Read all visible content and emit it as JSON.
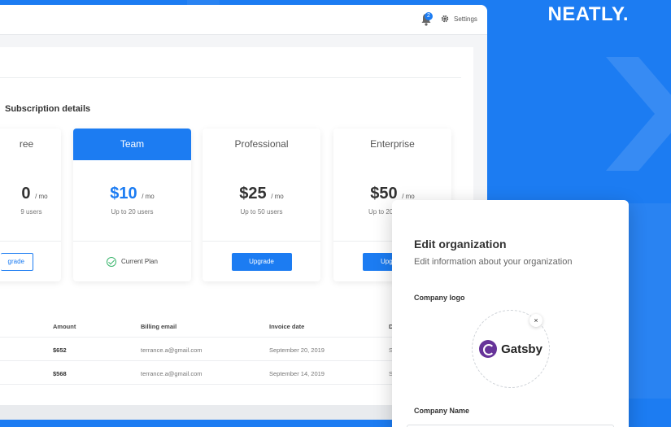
{
  "brand": {
    "name": "NEATLY."
  },
  "topbar": {
    "notification_count": "2",
    "settings_label": "Settings"
  },
  "subscription": {
    "title": "Subscription details",
    "plans": [
      {
        "name": "Free",
        "visible_name": "ree",
        "price": "0",
        "per": "/ mo",
        "users": "9 users",
        "action": "Upgrade",
        "visible_action": "grade"
      },
      {
        "name": "Team",
        "price": "$10",
        "per": "/ mo",
        "users": "Up to 20 users",
        "action": "Current Plan"
      },
      {
        "name": "Professional",
        "price": "$25",
        "per": "/ mo",
        "users": "Up to 50 users",
        "action": "Upgrade"
      },
      {
        "name": "Enterprise",
        "price": "$50",
        "per": "/ mo",
        "users": "Up to 20",
        "action": "Upg"
      }
    ]
  },
  "invoices": {
    "columns": [
      "Amount",
      "Billing email",
      "Invoice date",
      "D"
    ],
    "rows": [
      {
        "amount": "$652",
        "email": "terrance.a@gmail.com",
        "date": "September 20, 2019",
        "d": "S"
      },
      {
        "amount": "$568",
        "email": "terrance.a@gmail.com",
        "date": "September 14, 2019",
        "d": "S"
      }
    ]
  },
  "modal": {
    "title": "Edit organization",
    "subtitle": "Edit information about your organization",
    "logo_label": "Company logo",
    "logo_text": "Gatsby",
    "remove_symbol": "×",
    "name_label": "Company Name"
  },
  "colors": {
    "accent": "#1c7cf2",
    "success": "#3bb56d",
    "gatsby": "#663399"
  }
}
